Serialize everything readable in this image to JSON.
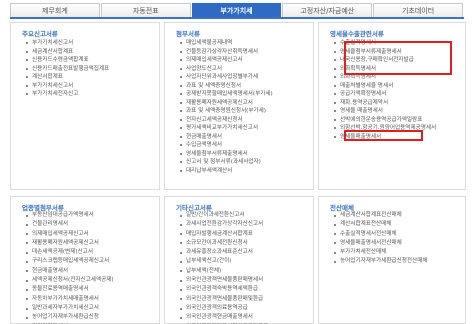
{
  "tabs": [
    "제무회계",
    "자동전표",
    "부가가치세",
    "고정자산/자금예산",
    "기초데이터"
  ],
  "active_tab": 2,
  "panels": [
    {
      "title": "주요신고서류",
      "items": [
        "부가가치세신고서",
        "세금계산서합계표",
        "신용카드수령금액합계표",
        "신용카드매출전표발행금액집계표",
        "계산서합계표",
        "부가가치세신고서",
        "부가가치세전자신고"
      ]
    },
    {
      "title": "첨부서류",
      "items": [
        "매입세액불공제내역",
        "건물등감가상각자산취득명세서",
        "의제매입세액공제신고서",
        "사업양도신고서",
        "사업자단위과세사업장별부가세",
        "과표 및 세액증명신청서",
        "공제받지못할매입세액명세서(부가세)",
        "재활용폐자원세액공제신고서",
        "과표 및 세액증명원신청서(부가세)",
        "전자신고세액공제신청서",
        "평가세액비교부가가치세신고서",
        "현금매출명세서",
        "수입금액명세서",
        "영세율첨부서류제출명세서",
        "신고서 및 첨부서류(과세사업자)",
        "대리납부세액계산서"
      ]
    },
    {
      "title": "영세율수출관련서류",
      "items": [
        "수출실적명세서",
        "영세율첨부서류제출명세서",
        "내국신용장,구매확인서전자발급",
        "외화획득명세서",
        "외화획득명세서",
        "매출처별영세율 명세서",
        "공급가액확정명세서",
        "재화.용역공급계약서",
        "영세율 매출명세서",
        "선박에의한운송용역공급가액일람표",
        "외항선박.항공기.원양어업용역제공명세서",
        "영세율매출명세서"
      ]
    },
    {
      "title": "업종별첨부서류",
      "items": [
        "부동산임대공급가액명세서",
        "건물관리명세서",
        "의제매입세액공제신고서",
        "재활용폐자원세액공제신고서",
        "대손세액공제(변제)신고서",
        "구리스크랩등매입세액공제신고서",
        "현금매출명세서",
        "세액공제신청서(전자신고세액공제)",
        "동물진료용역매출명세서",
        "자동차부가가치세매출명세서",
        "일반과세자부가가치세신고서",
        "농어업기자재부가세환급신청",
        "건강검진명세서"
      ]
    },
    {
      "title": "기타신고서류",
      "items": [
        "일반/간이과세전환신고서",
        "과세사업전환감가상각자산신고서",
        "매입자발행세금계산서합계표",
        "소규모간이과세전환신청서",
        "과세유흥장소과세표준신고서",
        "납부세액신고(간이)",
        "납부세액(전체)",
        "외국인관광객면세물품판매명세서",
        "외국인관광객숙박용역세액환급",
        "외국인관광객면세물품판매및환급",
        "외국인관광객의료용역공급",
        "외국인관광객현금매출명세서",
        "외국인관광객미용성형의료용역공급"
      ]
    },
    {
      "title": "전산매체",
      "items": [
        "세금계산서합계표전산매체",
        "계산서합계표전산매체",
        "수출실적명세서전산매체",
        "영세율매출명세서전산매체",
        "부가가치세전산매체",
        "농어업기자재부가세환급신청전산매체"
      ]
    }
  ]
}
